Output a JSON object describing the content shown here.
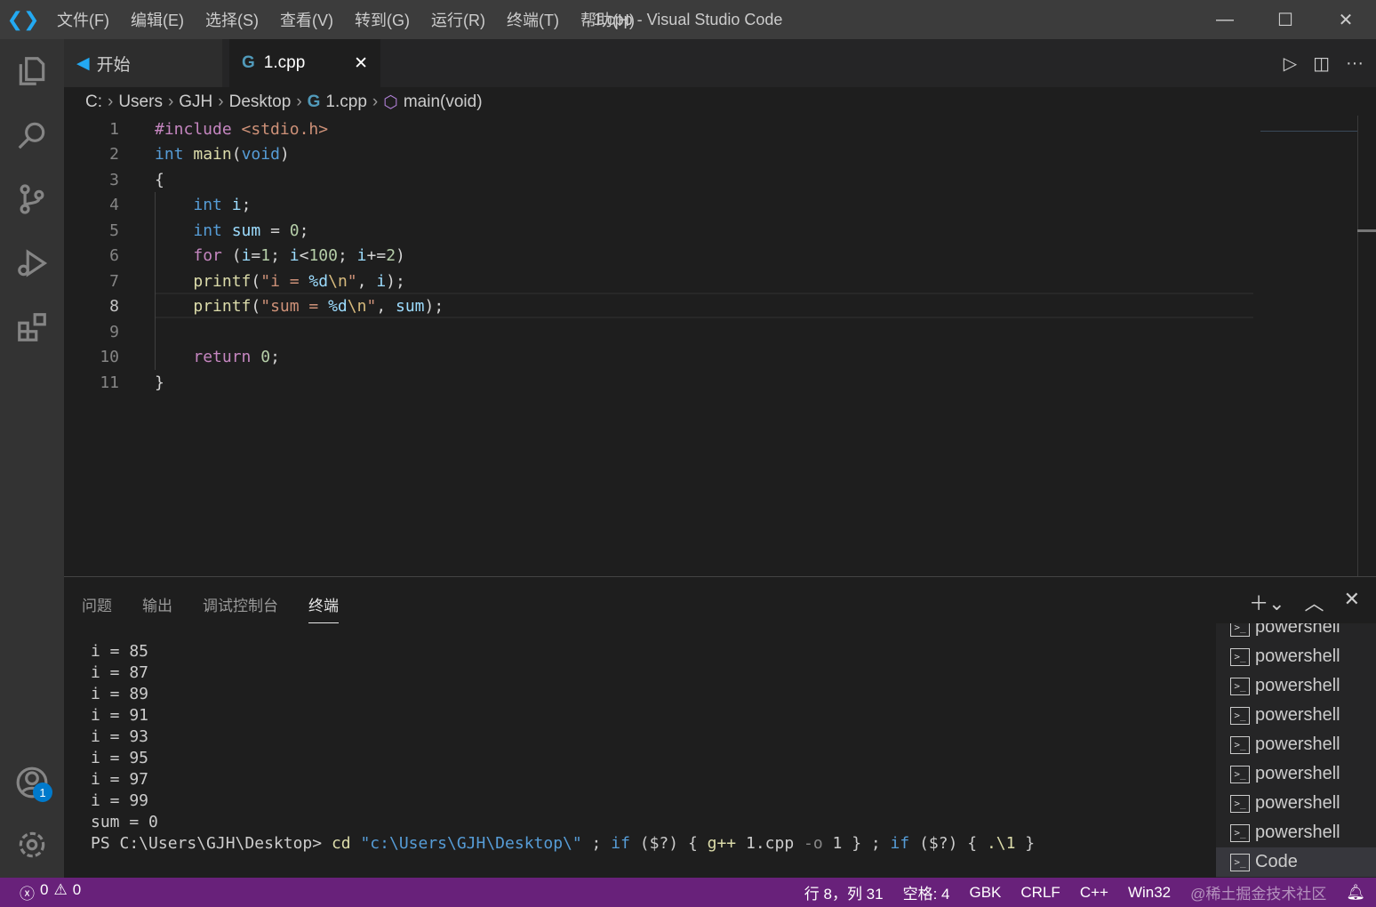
{
  "window": {
    "title": "1.cpp - Visual Studio Code",
    "menu": [
      "文件(F)",
      "编辑(E)",
      "选择(S)",
      "查看(V)",
      "转到(G)",
      "运行(R)",
      "终端(T)",
      "帮助(H)"
    ]
  },
  "activity": {
    "items": [
      "explorer-icon",
      "search-icon",
      "source-control-icon",
      "run-debug-icon",
      "extensions-icon"
    ],
    "accounts_badge": "1"
  },
  "tabs": [
    {
      "label": "开始"
    },
    {
      "label": "1.cpp"
    }
  ],
  "breadcrumb": [
    "C:",
    "Users",
    "GJH",
    "Desktop",
    "1.cpp",
    "main(void)"
  ],
  "editor": {
    "current_line": 8,
    "lines": [
      [
        [
          "pp",
          "#include "
        ],
        [
          "inc",
          "<stdio.h>"
        ]
      ],
      [
        [
          "kw",
          "int "
        ],
        [
          "fn",
          "main"
        ],
        [
          "p",
          "("
        ],
        [
          "kw",
          "void"
        ],
        [
          "p",
          ")"
        ]
      ],
      [
        [
          "p",
          "{"
        ]
      ],
      [
        [
          "p",
          "    "
        ],
        [
          "kw",
          "int "
        ],
        [
          "var",
          "i"
        ],
        [
          "p",
          ";"
        ]
      ],
      [
        [
          "p",
          "    "
        ],
        [
          "kw",
          "int "
        ],
        [
          "var",
          "sum"
        ],
        [
          "p",
          " = "
        ],
        [
          "num",
          "0"
        ],
        [
          "p",
          ";"
        ]
      ],
      [
        [
          "p",
          "    "
        ],
        [
          "pp",
          "for "
        ],
        [
          "p",
          "("
        ],
        [
          "var",
          "i"
        ],
        [
          "p",
          "="
        ],
        [
          "num",
          "1"
        ],
        [
          "p",
          "; "
        ],
        [
          "var",
          "i"
        ],
        [
          "p",
          "<"
        ],
        [
          "num",
          "100"
        ],
        [
          "p",
          "; "
        ],
        [
          "var",
          "i"
        ],
        [
          "p",
          "+="
        ],
        [
          "num",
          "2"
        ],
        [
          "p",
          ")"
        ]
      ],
      [
        [
          "p",
          "    "
        ],
        [
          "fn",
          "printf"
        ],
        [
          "p",
          "("
        ],
        [
          "str",
          "\"i = "
        ],
        [
          "fmt",
          "%d"
        ],
        [
          "esc",
          "\\n"
        ],
        [
          "str",
          "\""
        ],
        [
          "p",
          ", "
        ],
        [
          "var",
          "i"
        ],
        [
          "p",
          ");"
        ]
      ],
      [
        [
          "p",
          "    "
        ],
        [
          "fn",
          "printf"
        ],
        [
          "p",
          "("
        ],
        [
          "str",
          "\"sum = "
        ],
        [
          "fmt",
          "%d"
        ],
        [
          "esc",
          "\\n"
        ],
        [
          "str",
          "\""
        ],
        [
          "p",
          ", "
        ],
        [
          "var",
          "sum"
        ],
        [
          "p",
          ");"
        ]
      ],
      [],
      [
        [
          "p",
          "    "
        ],
        [
          "pp",
          "return "
        ],
        [
          "num",
          "0"
        ],
        [
          "p",
          ";"
        ]
      ],
      [
        [
          "p",
          "}"
        ]
      ]
    ]
  },
  "panel": {
    "tabs": [
      "问题",
      "输出",
      "调试控制台",
      "终端"
    ],
    "active_tab": "终端",
    "output": [
      "i = 85",
      "i = 87",
      "i = 89",
      "i = 91",
      "i = 93",
      "i = 95",
      "i = 97",
      "i = 99",
      "sum = 0"
    ],
    "prompt": "PS C:\\Users\\GJH\\Desktop> ",
    "command": [
      [
        "cmd",
        "cd"
      ],
      [
        "p",
        " "
      ],
      [
        "str",
        "\"c:\\Users\\GJH\\Desktop\\\""
      ],
      [
        "p",
        " ; "
      ],
      [
        "kw",
        "if"
      ],
      [
        "p",
        " ($?) { "
      ],
      [
        "g",
        "g++"
      ],
      [
        "p",
        " 1.cpp "
      ],
      [
        "o",
        "-o"
      ],
      [
        "p",
        " 1 } ; "
      ],
      [
        "kw",
        "if"
      ],
      [
        "p",
        " ($?) { "
      ],
      [
        "g",
        ".\\1"
      ],
      [
        "p",
        " }"
      ]
    ],
    "terminals": [
      "powershell",
      "powershell",
      "powershell",
      "powershell",
      "powershell",
      "powershell",
      "powershell",
      "powershell",
      "Code"
    ],
    "selected_terminal": "Code"
  },
  "status": {
    "errors": "0",
    "warnings": "0",
    "position": "行 8，列 31",
    "spaces": "空格: 4",
    "encoding": "GBK",
    "eol": "CRLF",
    "language": "C++",
    "platform": "Win32",
    "watermark": "@稀土掘金技术社区"
  },
  "colors": {
    "status_bar": "#68217a",
    "editor_bg": "#1e1e1e",
    "accent": "#007acc"
  }
}
